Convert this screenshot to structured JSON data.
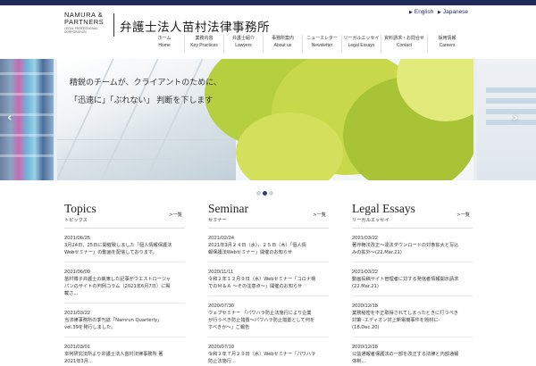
{
  "logo": {
    "en_line1": "NAMURA &",
    "en_line2": "PARTNERS",
    "en_sub1": "LEGAL PROFESSIONAL",
    "en_sub2": "CORPORATION",
    "jp": "弁護士法人苗村法律事務所"
  },
  "lang": {
    "english": "English",
    "japanese": "Japanese"
  },
  "nav": [
    {
      "jp": "ホーム",
      "en": "Home"
    },
    {
      "jp": "業務内容",
      "en": "Key Practices"
    },
    {
      "jp": "弁護士紹介",
      "en": "Lawyers"
    },
    {
      "jp": "事務所案内",
      "en": "About us"
    },
    {
      "jp": "ニュースレター",
      "en": "Newsletter"
    },
    {
      "jp": "リーガルエッセイ",
      "en": "Legal Essays"
    },
    {
      "jp": "資料請求・お問合せ",
      "en": "Contact"
    },
    {
      "jp": "採用情報",
      "en": "Careers"
    }
  ],
  "hero": {
    "line1": "精鋭のチームが、クライアントのために、",
    "line2": "「迅速に」「ぶれない」 判断を下します",
    "prev": "‹",
    "next": "›"
  },
  "columns": [
    {
      "title": "Topics",
      "sub": "トピックス",
      "more": ">一覧",
      "entries": [
        {
          "date": "2021/06/25",
          "text": [
            "3月24日、25日に開催致しました「個人情報保護法",
            "Webセミナー」の動画を配信しております。"
          ]
        },
        {
          "date": "2021/06/09",
          "text": [
            "苗村博子弁護士の執筆した記事がウエストロージャ",
            "パンのサイトの判例コラム（2021年6月7日）に掲",
            "載さ..."
          ]
        },
        {
          "date": "2021/03/22",
          "text": [
            "当法律事務所の季刊誌「Namrun Quarterly」",
            "vol.39を発行しました。"
          ]
        },
        {
          "date": "2021/03/01",
          "text": [
            "本何研究法所より弁護士法人苗村法律事務所 著",
            "2021年3月..."
          ]
        }
      ]
    },
    {
      "title": "Seminar",
      "sub": "セミナー",
      "more": ">一覧",
      "entries": [
        {
          "date": "2021/02/24",
          "text": [
            "2021年3月２４日（水），２５日（木）「個人情",
            "報保護法Webセミナー」開催のお知らせ"
          ]
        },
        {
          "date": "2020/11/11",
          "text": [
            "令和２年１２月９日（水）Webセミナー「コロナ禍",
            "でのＭ＆Ａ ～その注意点～」開催のお知らせ"
          ]
        },
        {
          "date": "2020/07/30",
          "text": [
            "ウェブセミナー 「パワハラ防止法施行により企業",
            "が行うべき防止措置～パワハラ防止措置として何を",
            "すべきか～」ご報告"
          ]
        },
        {
          "date": "2020/07/10",
          "text": [
            "令和２年７月２９日（水）Webセミナー「パワハラ",
            "防止法施行..."
          ]
        }
      ]
    },
    {
      "title": "Legal Essays",
      "sub": "リーガルエッセイ",
      "more": ">一覧",
      "entries": [
        {
          "date": "2021/03/22",
          "text": [
            "著作権法改正～違法ダウンロードの対象拡大と写込",
            "みの拡外～(22.Mar.21)"
          ]
        },
        {
          "date": "2021/03/22",
          "text": [
            "動画投稿サイト管理者に対する発信者情報開示請求",
            "(22.Mar.21)"
          ]
        },
        {
          "date": "2020/12/18",
          "text": [
            "業務秘密を不正取得されてしまったときに打つべき",
            "対策 -エディオン対上新電機事件を題材に-",
            "(18.Dec.20)"
          ]
        },
        {
          "date": "2020/12/18",
          "text": [
            "公益通報者保護法の一部を改正する法律と内部通報",
            "体制..."
          ]
        }
      ]
    }
  ]
}
